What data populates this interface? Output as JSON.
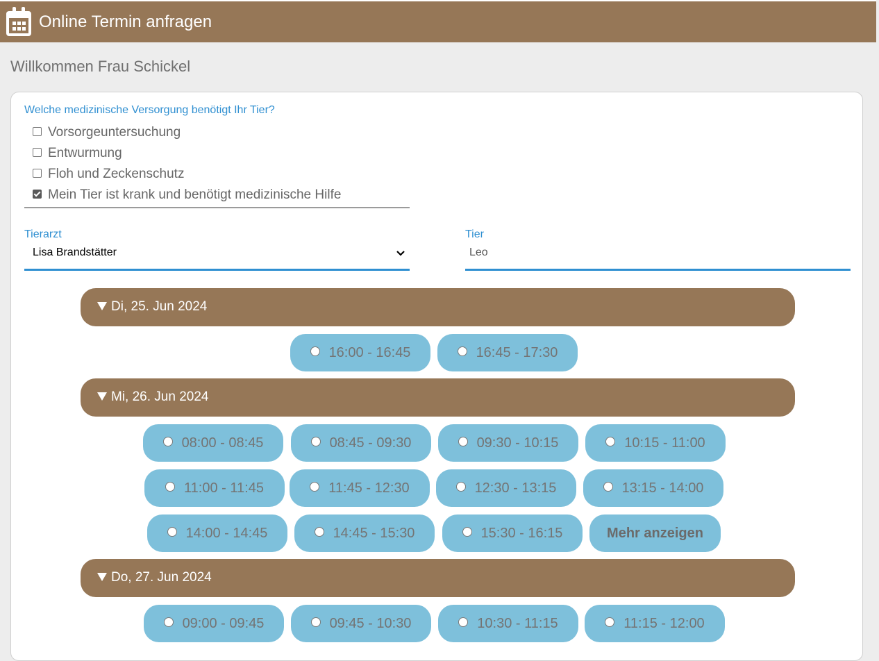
{
  "header": {
    "title": "Online Termin anfragen",
    "icon": "calendar-icon"
  },
  "welcome": "Willkommen Frau Schickel",
  "care": {
    "question": "Welche medizinische Versorgung benötigt Ihr Tier?",
    "options": [
      {
        "label": "Vorsorgeuntersuchung",
        "checked": false
      },
      {
        "label": "Entwurmung",
        "checked": false
      },
      {
        "label": "Floh und Zeckenschutz",
        "checked": false
      },
      {
        "label": "Mein Tier ist krank und benötigt medizinische Hilfe",
        "checked": true
      }
    ]
  },
  "vet": {
    "label": "Tierarzt",
    "value": "Lisa Brandstätter"
  },
  "pet": {
    "label": "Tier",
    "value": "Leo"
  },
  "days": [
    {
      "label": "Di, 25. Jun 2024",
      "slots": [
        "16:00 - 16:45",
        "16:45 - 17:30"
      ]
    },
    {
      "label": "Mi, 26. Jun 2024",
      "slots": [
        "08:00 - 08:45",
        "08:45 - 09:30",
        "09:30 - 10:15",
        "10:15 - 11:00",
        "11:00 - 11:45",
        "11:45 - 12:30",
        "12:30 - 13:15",
        "13:15 - 14:00",
        "14:00 - 14:45",
        "14:45 - 15:30",
        "15:30 - 16:15"
      ],
      "more_label": "Mehr anzeigen"
    },
    {
      "label": "Do, 27. Jun 2024",
      "slots": [
        "09:00 - 09:45",
        "09:45 - 10:30",
        "10:30 - 11:15",
        "11:15 - 12:00"
      ]
    }
  ],
  "colors": {
    "brand": "#967757",
    "slot": "#7ec0db",
    "accent": "#2f8fd1"
  }
}
